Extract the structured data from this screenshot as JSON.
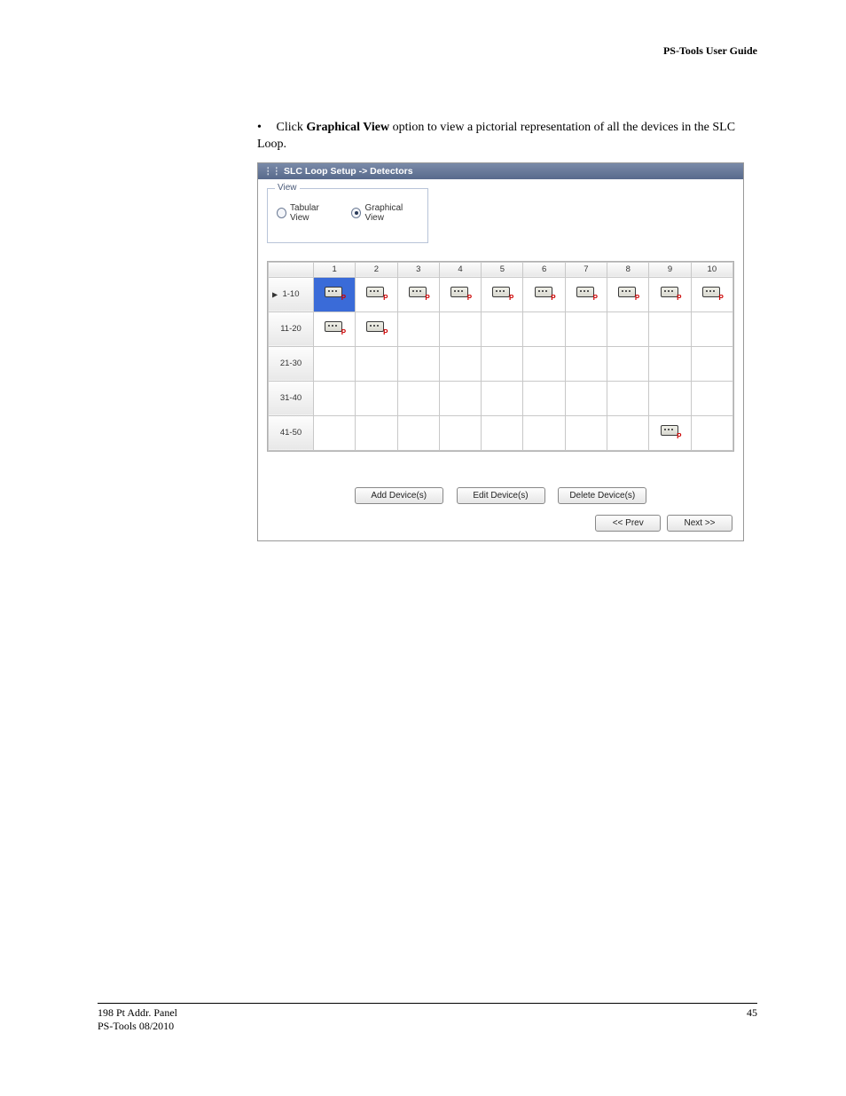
{
  "header": {
    "doc_title": "PS-Tools User Guide"
  },
  "instruction": {
    "prefix": "Click ",
    "bold": "Graphical View",
    "suffix": " option to view a pictorial representation of all the devices in the SLC Loop."
  },
  "window": {
    "title": "SLC Loop Setup -> Detectors",
    "view_group": {
      "legend": "View",
      "tabular": "Tabular View",
      "graphical": "Graphical View"
    },
    "columns": [
      "1",
      "2",
      "3",
      "4",
      "5",
      "6",
      "7",
      "8",
      "9",
      "10"
    ],
    "rows": [
      {
        "label": "1-10",
        "selected": true,
        "cells": [
          true,
          true,
          true,
          true,
          true,
          true,
          true,
          true,
          true,
          true
        ],
        "sel_col": 0
      },
      {
        "label": "11-20",
        "cells": [
          true,
          true,
          false,
          false,
          false,
          false,
          false,
          false,
          false,
          false
        ]
      },
      {
        "label": "21-30",
        "cells": [
          false,
          false,
          false,
          false,
          false,
          false,
          false,
          false,
          false,
          false
        ]
      },
      {
        "label": "31-40",
        "cells": [
          false,
          false,
          false,
          false,
          false,
          false,
          false,
          false,
          false,
          false
        ]
      },
      {
        "label": "41-50",
        "cells": [
          false,
          false,
          false,
          false,
          false,
          false,
          false,
          false,
          true,
          false
        ]
      }
    ],
    "buttons": {
      "add": "Add Device(s)",
      "edit": "Edit Device(s)",
      "delete": "Delete Device(s)",
      "prev": "<< Prev",
      "next": "Next >>"
    }
  },
  "footer": {
    "line1": "198 Pt Addr. Panel",
    "line2": "PS-Tools  08/2010",
    "page": "45"
  }
}
